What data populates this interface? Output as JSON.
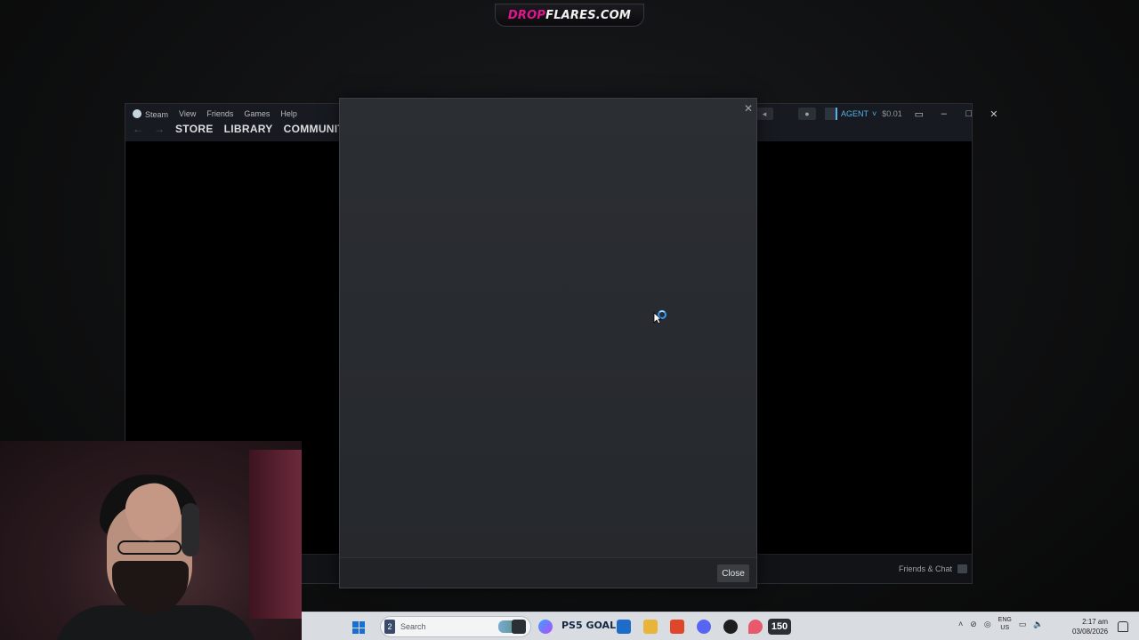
{
  "banner": {
    "part1": "DROP",
    "part2": "FLARES.COM"
  },
  "steam": {
    "menu": [
      "Steam",
      "View",
      "Friends",
      "Games",
      "Help"
    ],
    "nav_tabs": [
      "STORE",
      "LIBRARY",
      "COMMUNITY"
    ],
    "account_name": "AGENT",
    "wallet_balance": "$0.01",
    "friends_chat_label": "Friends & Chat"
  },
  "dialog": {
    "close_button_label": "Close",
    "close_glyph": "✕",
    "loading": true
  },
  "taskbar": {
    "search_placeholder": "Search",
    "search_badge": "2",
    "pinned_label": "PS5 GOAL",
    "badge_count": "150",
    "language_top": "ENG",
    "language_bottom": "US",
    "time": "2:17 am",
    "date": "03/08/2026"
  },
  "colors": {
    "accent": "#57b3e8",
    "banner_pink": "#e1158f",
    "spinner": "#2f9bff"
  }
}
